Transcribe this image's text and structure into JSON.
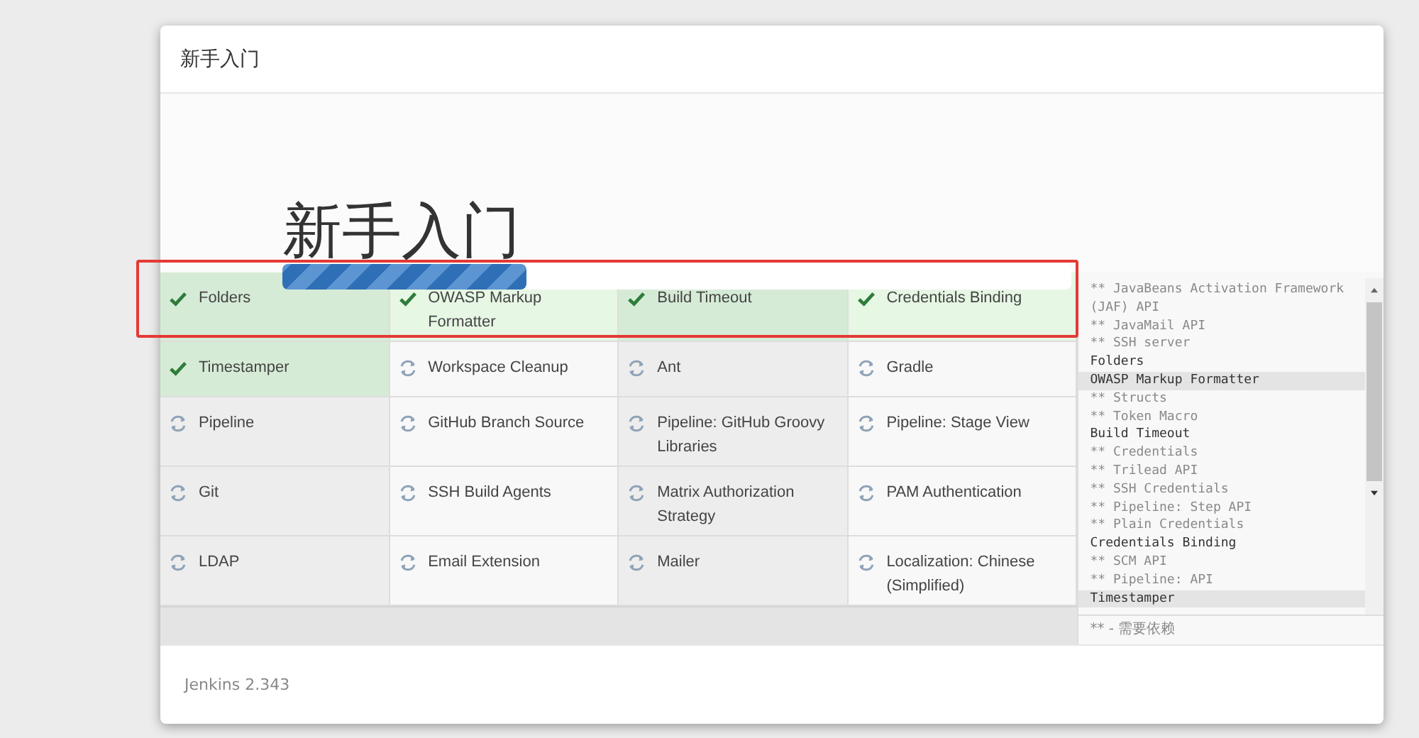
{
  "dialog": {
    "title": "新手入门"
  },
  "heading": "新手入门",
  "progress": {
    "level": 0.31
  },
  "plugins": [
    {
      "name": "Folders",
      "installed": true
    },
    {
      "name": "OWASP Markup Formatter",
      "installed": true
    },
    {
      "name": "Build Timeout",
      "installed": true
    },
    {
      "name": "Credentials Binding",
      "installed": true
    },
    {
      "name": "Timestamper",
      "installed": true
    },
    {
      "name": "Workspace Cleanup",
      "installed": false
    },
    {
      "name": "Ant",
      "installed": false
    },
    {
      "name": "Gradle",
      "installed": false
    },
    {
      "name": "Pipeline",
      "installed": false
    },
    {
      "name": "GitHub Branch Source",
      "installed": false
    },
    {
      "name": "Pipeline: GitHub Groovy Libraries",
      "installed": false
    },
    {
      "name": "Pipeline: Stage View",
      "installed": false
    },
    {
      "name": "Git",
      "installed": false
    },
    {
      "name": "SSH Build Agents",
      "installed": false
    },
    {
      "name": "Matrix Authorization Strategy",
      "installed": false
    },
    {
      "name": "PAM Authentication",
      "installed": false
    },
    {
      "name": "LDAP",
      "installed": false
    },
    {
      "name": "Email Extension",
      "installed": false
    },
    {
      "name": "Mailer",
      "installed": false
    },
    {
      "name": "Localization: Chinese (Simplified)",
      "installed": false
    }
  ],
  "log": [
    {
      "text": "** JavaBeans Activation Framework",
      "kind": "dependency",
      "highlighted": false
    },
    {
      "text": "(JAF) API",
      "kind": "dependency",
      "highlighted": false
    },
    {
      "text": "** JavaMail API",
      "kind": "dependency",
      "highlighted": false
    },
    {
      "text": "** SSH server",
      "kind": "dependency",
      "highlighted": false
    },
    {
      "text": "Folders",
      "kind": "plugin",
      "highlighted": false
    },
    {
      "text": "OWASP Markup Formatter",
      "kind": "plugin",
      "highlighted": true
    },
    {
      "text": "** Structs",
      "kind": "dependency",
      "highlighted": false
    },
    {
      "text": "** Token Macro",
      "kind": "dependency",
      "highlighted": false
    },
    {
      "text": "Build Timeout",
      "kind": "plugin",
      "highlighted": false
    },
    {
      "text": "** Credentials",
      "kind": "dependency",
      "highlighted": false
    },
    {
      "text": "** Trilead API",
      "kind": "dependency",
      "highlighted": false
    },
    {
      "text": "** SSH Credentials",
      "kind": "dependency",
      "highlighted": false
    },
    {
      "text": "** Pipeline: Step API",
      "kind": "dependency",
      "highlighted": false
    },
    {
      "text": "** Plain Credentials",
      "kind": "dependency",
      "highlighted": false
    },
    {
      "text": "Credentials Binding",
      "kind": "plugin",
      "highlighted": false
    },
    {
      "text": "** SCM API",
      "kind": "dependency",
      "highlighted": false
    },
    {
      "text": "** Pipeline: API",
      "kind": "dependency",
      "highlighted": false
    },
    {
      "text": "Timestamper",
      "kind": "plugin",
      "highlighted": true
    }
  ],
  "log_legend": "** - 需要依赖",
  "footer": {
    "version": "Jenkins 2.343"
  }
}
